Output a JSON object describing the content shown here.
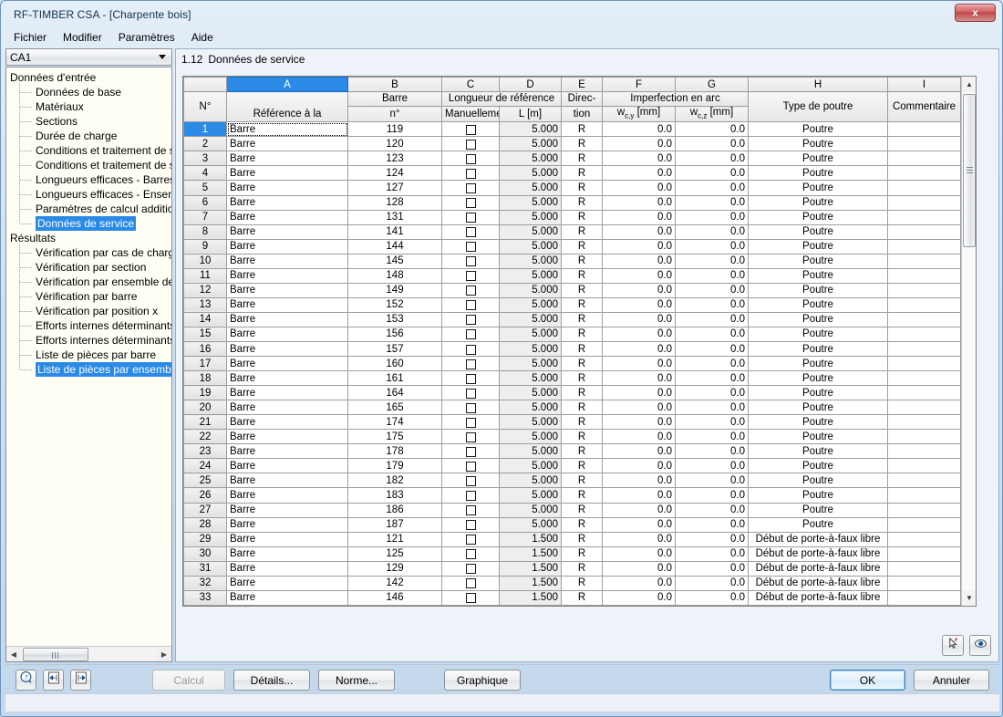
{
  "window": {
    "title": "RF-TIMBER CSA - [Charpente bois]",
    "close_label": "x"
  },
  "menubar": {
    "items": [
      "Fichier",
      "Modifier",
      "Paramètres",
      "Aide"
    ]
  },
  "sidebar": {
    "combo": {
      "value": "CA1"
    },
    "tree": [
      {
        "label": "Données d'entrée",
        "level": 0,
        "selected": false
      },
      {
        "label": "Données de base",
        "level": 1,
        "selected": false
      },
      {
        "label": "Matériaux",
        "level": 1,
        "selected": false
      },
      {
        "label": "Sections",
        "level": 1,
        "selected": false
      },
      {
        "label": "Durée de charge",
        "level": 1,
        "selected": false
      },
      {
        "label": "Conditions et traitement de ser",
        "level": 1,
        "selected": false
      },
      {
        "label": "Conditions et traitement de ser",
        "level": 1,
        "selected": false
      },
      {
        "label": "Longueurs efficaces - Barres",
        "level": 1,
        "selected": false
      },
      {
        "label": "Longueurs efficaces - Ensemble",
        "level": 1,
        "selected": false
      },
      {
        "label": "Paramètres de calcul additionne",
        "level": 1,
        "selected": false
      },
      {
        "label": "Données de service",
        "level": 1,
        "selected": true,
        "last": true
      },
      {
        "label": "Résultats",
        "level": 0,
        "selected": false
      },
      {
        "label": "Vérification par cas de charge",
        "level": 1,
        "selected": false
      },
      {
        "label": "Vérification par section",
        "level": 1,
        "selected": false
      },
      {
        "label": "Vérification par ensemble de ba",
        "level": 1,
        "selected": false
      },
      {
        "label": "Vérification par barre",
        "level": 1,
        "selected": false
      },
      {
        "label": "Vérification par position x",
        "level": 1,
        "selected": false
      },
      {
        "label": "Efforts internes déterminants p",
        "level": 1,
        "selected": false
      },
      {
        "label": "Efforts internes déterminants p",
        "level": 1,
        "selected": false
      },
      {
        "label": "Liste de pièces par barre",
        "level": 1,
        "selected": false
      },
      {
        "label": "Liste de pièces par ensemble de",
        "level": 1,
        "selected": true,
        "last": true
      }
    ]
  },
  "section": {
    "number": "1.12",
    "title": "Données de service"
  },
  "table": {
    "letter_headers": [
      "",
      "A",
      "B",
      "C",
      "D",
      "E",
      "F",
      "G",
      "H",
      "I"
    ],
    "selected_letter": "A",
    "group_headers": {
      "rownum": "N°",
      "ref": "Référence à la",
      "barre_top": "Barre",
      "barre_bottom": "n°",
      "longueur_group": "Longueur de référence",
      "manuelle": "Manuelleme",
      "l_unit": "L [m]",
      "direction_top": "Direc-",
      "direction_bottom": "tion",
      "imperfection_group": "Imperfection en arc",
      "wcy": "w c,y [mm]",
      "wcy_main": "w",
      "wcy_sub": "c,y",
      "wcy_unit": " [mm]",
      "wcz_main": "w",
      "wcz_sub": "c,z",
      "wcz_unit": " [mm]",
      "type": "Type de poutre",
      "comment": "Commentaire"
    },
    "rows": [
      {
        "n": "1",
        "ref": "Barre",
        "barre": "119",
        "manuelle": false,
        "L": "5.000",
        "dir": "R",
        "wcy": "0.0",
        "wcz": "0.0",
        "type": "Poutre",
        "comment": ""
      },
      {
        "n": "2",
        "ref": "Barre",
        "barre": "120",
        "manuelle": false,
        "L": "5.000",
        "dir": "R",
        "wcy": "0.0",
        "wcz": "0.0",
        "type": "Poutre",
        "comment": ""
      },
      {
        "n": "3",
        "ref": "Barre",
        "barre": "123",
        "manuelle": false,
        "L": "5.000",
        "dir": "R",
        "wcy": "0.0",
        "wcz": "0.0",
        "type": "Poutre",
        "comment": ""
      },
      {
        "n": "4",
        "ref": "Barre",
        "barre": "124",
        "manuelle": false,
        "L": "5.000",
        "dir": "R",
        "wcy": "0.0",
        "wcz": "0.0",
        "type": "Poutre",
        "comment": ""
      },
      {
        "n": "5",
        "ref": "Barre",
        "barre": "127",
        "manuelle": false,
        "L": "5.000",
        "dir": "R",
        "wcy": "0.0",
        "wcz": "0.0",
        "type": "Poutre",
        "comment": ""
      },
      {
        "n": "6",
        "ref": "Barre",
        "barre": "128",
        "manuelle": false,
        "L": "5.000",
        "dir": "R",
        "wcy": "0.0",
        "wcz": "0.0",
        "type": "Poutre",
        "comment": ""
      },
      {
        "n": "7",
        "ref": "Barre",
        "barre": "131",
        "manuelle": false,
        "L": "5.000",
        "dir": "R",
        "wcy": "0.0",
        "wcz": "0.0",
        "type": "Poutre",
        "comment": ""
      },
      {
        "n": "8",
        "ref": "Barre",
        "barre": "141",
        "manuelle": false,
        "L": "5.000",
        "dir": "R",
        "wcy": "0.0",
        "wcz": "0.0",
        "type": "Poutre",
        "comment": ""
      },
      {
        "n": "9",
        "ref": "Barre",
        "barre": "144",
        "manuelle": false,
        "L": "5.000",
        "dir": "R",
        "wcy": "0.0",
        "wcz": "0.0",
        "type": "Poutre",
        "comment": ""
      },
      {
        "n": "10",
        "ref": "Barre",
        "barre": "145",
        "manuelle": false,
        "L": "5.000",
        "dir": "R",
        "wcy": "0.0",
        "wcz": "0.0",
        "type": "Poutre",
        "comment": ""
      },
      {
        "n": "11",
        "ref": "Barre",
        "barre": "148",
        "manuelle": false,
        "L": "5.000",
        "dir": "R",
        "wcy": "0.0",
        "wcz": "0.0",
        "type": "Poutre",
        "comment": ""
      },
      {
        "n": "12",
        "ref": "Barre",
        "barre": "149",
        "manuelle": false,
        "L": "5.000",
        "dir": "R",
        "wcy": "0.0",
        "wcz": "0.0",
        "type": "Poutre",
        "comment": ""
      },
      {
        "n": "13",
        "ref": "Barre",
        "barre": "152",
        "manuelle": false,
        "L": "5.000",
        "dir": "R",
        "wcy": "0.0",
        "wcz": "0.0",
        "type": "Poutre",
        "comment": ""
      },
      {
        "n": "14",
        "ref": "Barre",
        "barre": "153",
        "manuelle": false,
        "L": "5.000",
        "dir": "R",
        "wcy": "0.0",
        "wcz": "0.0",
        "type": "Poutre",
        "comment": ""
      },
      {
        "n": "15",
        "ref": "Barre",
        "barre": "156",
        "manuelle": false,
        "L": "5.000",
        "dir": "R",
        "wcy": "0.0",
        "wcz": "0.0",
        "type": "Poutre",
        "comment": ""
      },
      {
        "n": "16",
        "ref": "Barre",
        "barre": "157",
        "manuelle": false,
        "L": "5.000",
        "dir": "R",
        "wcy": "0.0",
        "wcz": "0.0",
        "type": "Poutre",
        "comment": ""
      },
      {
        "n": "17",
        "ref": "Barre",
        "barre": "160",
        "manuelle": false,
        "L": "5.000",
        "dir": "R",
        "wcy": "0.0",
        "wcz": "0.0",
        "type": "Poutre",
        "comment": ""
      },
      {
        "n": "18",
        "ref": "Barre",
        "barre": "161",
        "manuelle": false,
        "L": "5.000",
        "dir": "R",
        "wcy": "0.0",
        "wcz": "0.0",
        "type": "Poutre",
        "comment": ""
      },
      {
        "n": "19",
        "ref": "Barre",
        "barre": "164",
        "manuelle": false,
        "L": "5.000",
        "dir": "R",
        "wcy": "0.0",
        "wcz": "0.0",
        "type": "Poutre",
        "comment": ""
      },
      {
        "n": "20",
        "ref": "Barre",
        "barre": "165",
        "manuelle": false,
        "L": "5.000",
        "dir": "R",
        "wcy": "0.0",
        "wcz": "0.0",
        "type": "Poutre",
        "comment": ""
      },
      {
        "n": "21",
        "ref": "Barre",
        "barre": "174",
        "manuelle": false,
        "L": "5.000",
        "dir": "R",
        "wcy": "0.0",
        "wcz": "0.0",
        "type": "Poutre",
        "comment": ""
      },
      {
        "n": "22",
        "ref": "Barre",
        "barre": "175",
        "manuelle": false,
        "L": "5.000",
        "dir": "R",
        "wcy": "0.0",
        "wcz": "0.0",
        "type": "Poutre",
        "comment": ""
      },
      {
        "n": "23",
        "ref": "Barre",
        "barre": "178",
        "manuelle": false,
        "L": "5.000",
        "dir": "R",
        "wcy": "0.0",
        "wcz": "0.0",
        "type": "Poutre",
        "comment": ""
      },
      {
        "n": "24",
        "ref": "Barre",
        "barre": "179",
        "manuelle": false,
        "L": "5.000",
        "dir": "R",
        "wcy": "0.0",
        "wcz": "0.0",
        "type": "Poutre",
        "comment": ""
      },
      {
        "n": "25",
        "ref": "Barre",
        "barre": "182",
        "manuelle": false,
        "L": "5.000",
        "dir": "R",
        "wcy": "0.0",
        "wcz": "0.0",
        "type": "Poutre",
        "comment": ""
      },
      {
        "n": "26",
        "ref": "Barre",
        "barre": "183",
        "manuelle": false,
        "L": "5.000",
        "dir": "R",
        "wcy": "0.0",
        "wcz": "0.0",
        "type": "Poutre",
        "comment": ""
      },
      {
        "n": "27",
        "ref": "Barre",
        "barre": "186",
        "manuelle": false,
        "L": "5.000",
        "dir": "R",
        "wcy": "0.0",
        "wcz": "0.0",
        "type": "Poutre",
        "comment": ""
      },
      {
        "n": "28",
        "ref": "Barre",
        "barre": "187",
        "manuelle": false,
        "L": "5.000",
        "dir": "R",
        "wcy": "0.0",
        "wcz": "0.0",
        "type": "Poutre",
        "comment": ""
      },
      {
        "n": "29",
        "ref": "Barre",
        "barre": "121",
        "manuelle": false,
        "L": "1.500",
        "dir": "R",
        "wcy": "0.0",
        "wcz": "0.0",
        "type": "Début de porte-à-faux libre",
        "comment": ""
      },
      {
        "n": "30",
        "ref": "Barre",
        "barre": "125",
        "manuelle": false,
        "L": "1.500",
        "dir": "R",
        "wcy": "0.0",
        "wcz": "0.0",
        "type": "Début de porte-à-faux libre",
        "comment": ""
      },
      {
        "n": "31",
        "ref": "Barre",
        "barre": "129",
        "manuelle": false,
        "L": "1.500",
        "dir": "R",
        "wcy": "0.0",
        "wcz": "0.0",
        "type": "Début de porte-à-faux libre",
        "comment": ""
      },
      {
        "n": "32",
        "ref": "Barre",
        "barre": "142",
        "manuelle": false,
        "L": "1.500",
        "dir": "R",
        "wcy": "0.0",
        "wcz": "0.0",
        "type": "Début de porte-à-faux libre",
        "comment": ""
      },
      {
        "n": "33",
        "ref": "Barre",
        "barre": "146",
        "manuelle": false,
        "L": "1.500",
        "dir": "R",
        "wcy": "0.0",
        "wcz": "0.0",
        "type": "Début de porte-à-faux libre",
        "comment": ""
      }
    ],
    "tools": [
      {
        "name": "pick-in-model-icon"
      },
      {
        "name": "view-mode-icon"
      }
    ]
  },
  "bottombar": {
    "icon_buttons": [
      "help-icon",
      "import-icon",
      "export-icon"
    ],
    "calcul": "Calcul",
    "details": "Détails...",
    "norme": "Norme...",
    "graphique": "Graphique",
    "ok": "OK",
    "annuler": "Annuler"
  },
  "colors": {
    "accent": "#2a8ae6",
    "titlebar_text": "#14334d",
    "close_button": "#c04a4a",
    "grid_line": "#9d9d9d",
    "readonly_cell": "#eeeeee"
  }
}
